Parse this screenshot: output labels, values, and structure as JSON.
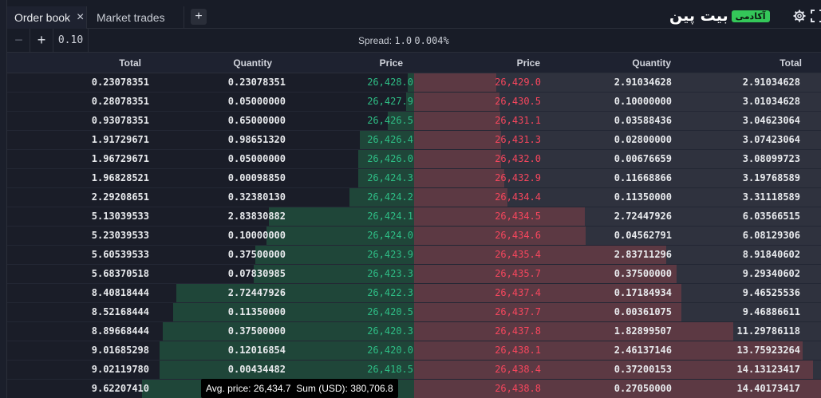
{
  "tabs": [
    {
      "label": "Order book",
      "active": true
    },
    {
      "label": "Market trades",
      "active": false
    }
  ],
  "add_tab_label": "+",
  "brand": {
    "logo_text": "بیت پین",
    "badge_text": "آکادمی"
  },
  "toolbar": {
    "minus_label": "−",
    "plus_label": "+",
    "step_value": "0.10",
    "spread_label": "Spread:",
    "spread_value": "1.0",
    "spread_percent": "0.004%"
  },
  "headers": {
    "bid_total": "Total",
    "bid_quantity": "Quantity",
    "bid_price": "Price",
    "ask_price": "Price",
    "ask_quantity": "Quantity",
    "ask_total": "Total"
  },
  "bids": [
    {
      "total": "0.23078351",
      "quantity": "0.23078351",
      "price": "26,428.0"
    },
    {
      "total": "0.28078351",
      "quantity": "0.05000000",
      "price": "26,427.9"
    },
    {
      "total": "0.93078351",
      "quantity": "0.65000000",
      "price": "26,426.5"
    },
    {
      "total": "1.91729671",
      "quantity": "0.98651320",
      "price": "26,426.4"
    },
    {
      "total": "1.96729671",
      "quantity": "0.05000000",
      "price": "26,426.0"
    },
    {
      "total": "1.96828521",
      "quantity": "0.00098850",
      "price": "26,424.3"
    },
    {
      "total": "2.29208651",
      "quantity": "0.32380130",
      "price": "26,424.2"
    },
    {
      "total": "5.13039533",
      "quantity": "2.83830882",
      "price": "26,424.1"
    },
    {
      "total": "5.23039533",
      "quantity": "0.10000000",
      "price": "26,424.0"
    },
    {
      "total": "5.60539533",
      "quantity": "0.37500000",
      "price": "26,423.9"
    },
    {
      "total": "5.68370518",
      "quantity": "0.07830985",
      "price": "26,423.3"
    },
    {
      "total": "8.40818444",
      "quantity": "2.72447926",
      "price": "26,422.3"
    },
    {
      "total": "8.52168444",
      "quantity": "0.11350000",
      "price": "26,420.5"
    },
    {
      "total": "8.89668444",
      "quantity": "0.37500000",
      "price": "26,420.3"
    },
    {
      "total": "9.01685298",
      "quantity": "0.12016854",
      "price": "26,420.0"
    },
    {
      "total": "9.02119780",
      "quantity": "0.00434482",
      "price": "26,418.5"
    },
    {
      "total": "9.62207410",
      "quantity": "",
      "price": ""
    }
  ],
  "asks": [
    {
      "price": "26,429.0",
      "quantity": "2.91034628",
      "total": "2.91034628"
    },
    {
      "price": "26,430.5",
      "quantity": "0.10000000",
      "total": "3.01034628"
    },
    {
      "price": "26,431.1",
      "quantity": "0.03588436",
      "total": "3.04623064"
    },
    {
      "price": "26,431.3",
      "quantity": "0.02800000",
      "total": "3.07423064"
    },
    {
      "price": "26,432.0",
      "quantity": "0.00676659",
      "total": "3.08099723"
    },
    {
      "price": "26,432.9",
      "quantity": "0.11668866",
      "total": "3.19768589"
    },
    {
      "price": "26,434.4",
      "quantity": "0.11350000",
      "total": "3.31118589"
    },
    {
      "price": "26,434.5",
      "quantity": "2.72447926",
      "total": "6.03566515"
    },
    {
      "price": "26,434.6",
      "quantity": "0.04562791",
      "total": "6.08129306"
    },
    {
      "price": "26,435.4",
      "quantity": "2.83711296",
      "total": "8.91840602"
    },
    {
      "price": "26,435.7",
      "quantity": "0.37500000",
      "total": "9.29340602"
    },
    {
      "price": "26,437.4",
      "quantity": "0.17184934",
      "total": "9.46525536"
    },
    {
      "price": "26,437.7",
      "quantity": "0.00361075",
      "total": "9.46886611"
    },
    {
      "price": "26,437.8",
      "quantity": "1.82899507",
      "total": "11.29786118"
    },
    {
      "price": "26,438.1",
      "quantity": "2.46137146",
      "total": "13.75923264"
    },
    {
      "price": "26,438.4",
      "quantity": "0.37200153",
      "total": "14.13123417"
    },
    {
      "price": "26,438.8",
      "quantity": "0.27050000",
      "total": "14.40173417"
    }
  ],
  "tooltip": {
    "avg_label": "Avg. price:",
    "avg_value": "26,434.7",
    "sum_label": "Sum (USD):",
    "sum_value": "380,706.8"
  },
  "colors": {
    "bid": "#2ebd85",
    "ask": "#f6465d",
    "background": "#131722"
  },
  "icons": {
    "close": "close-icon",
    "add": "plus-icon",
    "settings": "gear-icon",
    "expand": "expand-icon"
  }
}
